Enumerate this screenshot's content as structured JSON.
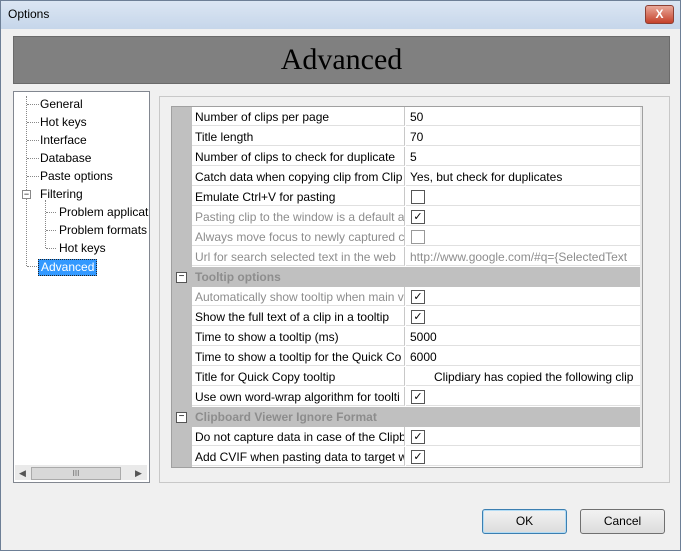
{
  "window": {
    "title": "Options",
    "close_glyph": "X"
  },
  "header": {
    "title": "Advanced"
  },
  "tree": {
    "items": [
      {
        "label": "General"
      },
      {
        "label": "Hot keys"
      },
      {
        "label": "Interface"
      },
      {
        "label": "Database"
      },
      {
        "label": "Paste options"
      },
      {
        "label": "Filtering"
      },
      {
        "label": "Problem applicat"
      },
      {
        "label": "Problem formats"
      },
      {
        "label": "Hot keys"
      },
      {
        "label": "Advanced"
      }
    ],
    "collapse_glyph": "−",
    "scroll_grip": "III",
    "scroll_left": "◀",
    "scroll_right": "▶"
  },
  "grid": {
    "rows": [
      {
        "name": "Number of clips per page",
        "value": "50"
      },
      {
        "name": "Title length",
        "value": "70"
      },
      {
        "name": "Number of clips to check for duplicate",
        "value": "5"
      },
      {
        "name": "Catch data when copying clip from Clip",
        "value": "Yes, but check for duplicates"
      },
      {
        "name": "Emulate Ctrl+V for pasting",
        "checked": ""
      },
      {
        "name": "Pasting clip to the window is a default a",
        "checked": "✓"
      },
      {
        "name": "Always move focus to newly captured c",
        "checked": ""
      },
      {
        "name": "Url for search selected text in the web",
        "value": "http://www.google.com/#q={SelectedText"
      },
      {
        "category": "Tooltip options",
        "glyph": "−"
      },
      {
        "name": "Automatically show tooltip when main v",
        "checked": "✓"
      },
      {
        "name": "Show the full text of a clip in a tooltip",
        "checked": "✓"
      },
      {
        "name": "Time to show a tooltip (ms)",
        "value": "5000"
      },
      {
        "name": "Time to show a tooltip for the Quick Co",
        "value": "6000"
      },
      {
        "name": "Title for Quick Copy tooltip",
        "value": "Clipdiary has copied the following clip"
      },
      {
        "name": "Use own word-wrap algorithm for toolti",
        "checked": "✓"
      },
      {
        "category": "Clipboard Viewer Ignore Format",
        "glyph": "−"
      },
      {
        "name": "Do not capture data in case of the Clipb",
        "checked": "✓"
      },
      {
        "name": "Add CVIF when pasting data to target w",
        "checked": "✓"
      }
    ],
    "scroll_up": "▲",
    "scroll_down": "▼",
    "scroll_grip": "≡"
  },
  "buttons": {
    "ok": "OK",
    "cancel": "Cancel"
  }
}
